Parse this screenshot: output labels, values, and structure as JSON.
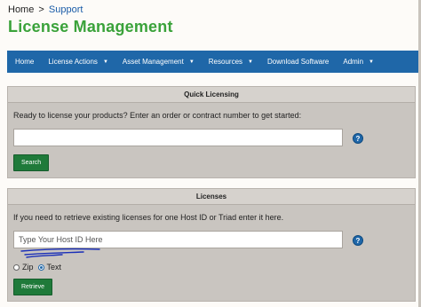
{
  "breadcrumb": {
    "home": "Home",
    "separator": ">",
    "current": "Support"
  },
  "page_title": "License Management",
  "nav": {
    "items": [
      {
        "label": "Home",
        "has_caret": false
      },
      {
        "label": "License Actions",
        "has_caret": true
      },
      {
        "label": "Asset Management",
        "has_caret": true
      },
      {
        "label": "Resources",
        "has_caret": true
      },
      {
        "label": "Download Software",
        "has_caret": false
      },
      {
        "label": "Admin",
        "has_caret": true
      }
    ],
    "caret_glyph": "▼"
  },
  "quick_licensing": {
    "header": "Quick Licensing",
    "instructions": "Ready to license your products? Enter an order or contract number to get started:",
    "input_value": "",
    "input_placeholder": "",
    "help_glyph": "?",
    "button_label": "Search"
  },
  "licenses": {
    "header": "Licenses",
    "instructions": "If you need to retrieve existing licenses for one Host ID or Triad enter it here.",
    "input_value": "",
    "input_placeholder": "Type Your Host ID Here",
    "help_glyph": "?",
    "options": [
      {
        "label": "Zip",
        "selected": false
      },
      {
        "label": "Text",
        "selected": true
      }
    ],
    "button_label": "Retrieve"
  },
  "colors": {
    "title_green": "#3aa23a",
    "nav_blue": "#1f67a8",
    "button_green": "#1f7a3a",
    "panel_gray": "#c9c5c0",
    "link_blue": "#1a5ca8",
    "annotation_scribble": "#1a2fb8"
  }
}
